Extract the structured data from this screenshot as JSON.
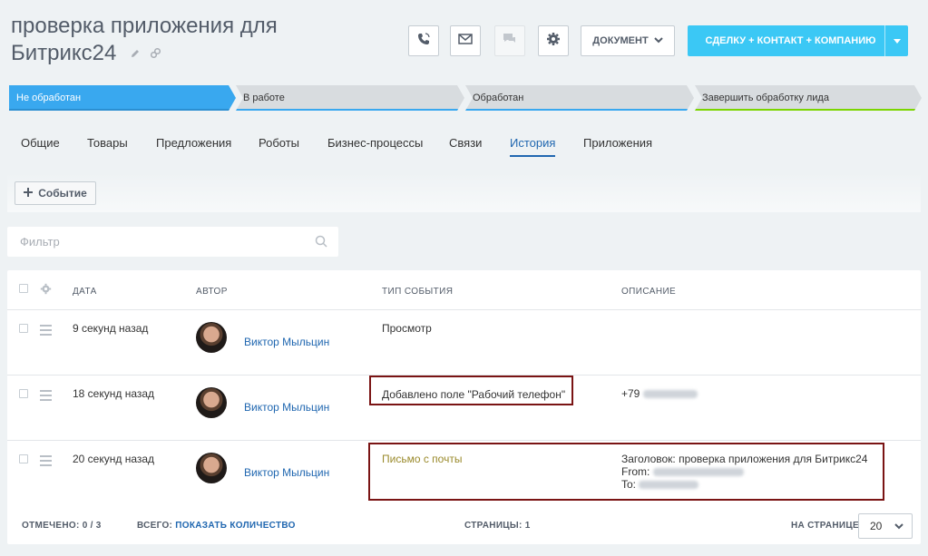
{
  "header": {
    "title_line1": "проверка приложения для",
    "title_line2": "Битрикс24",
    "document_button": "ДОКУМЕНТ",
    "main_button": "СДЕЛКУ + КОНТАКТ + КОМПАНИЮ"
  },
  "stages": [
    {
      "label": "Не обработан",
      "color": "#39a8ef"
    },
    {
      "label": "В работе",
      "color": "#39a8ef"
    },
    {
      "label": "Обработан",
      "color": "#39a8ef"
    },
    {
      "label": "Завершить обработку лида",
      "color": "#7bd500"
    }
  ],
  "tabs": [
    "Общие",
    "Товары",
    "Предложения",
    "Роботы",
    "Бизнес-процессы",
    "Связи",
    "История",
    "Приложения"
  ],
  "active_tab": "История",
  "toolbar": {
    "event_button": "Событие"
  },
  "filter": {
    "placeholder": "Фильтр"
  },
  "grid": {
    "columns": [
      "ДАТА",
      "АВТОР",
      "ТИП СОБЫТИЯ",
      "ОПИСАНИЕ"
    ],
    "rows": [
      {
        "date": "9 секунд назад",
        "author": "Виктор Мыльцин",
        "event_type": "Просмотр",
        "description": ""
      },
      {
        "date": "18 секунд назад",
        "author": "Виктор Мыльцин",
        "event_type": "Добавлено поле \"Рабочий телефон\"",
        "description": "+79"
      },
      {
        "date": "20 секунд назад",
        "author": "Виктор Мыльцин",
        "event_type": "Письмо с почты",
        "description": "Заголовок: проверка приложения для Битрикс24",
        "from_label": "From:",
        "to_label": "To:"
      }
    ]
  },
  "footer": {
    "selected_label": "ОТМЕЧЕНО: 0 / 3",
    "total_label": "ВСЕГО:",
    "total_link": "ПОКАЗАТЬ КОЛИЧЕСТВО",
    "pages_label": "СТРАНИЦЫ: 1",
    "per_page_label": "НА СТРАНИЦЕ:",
    "per_page_value": "20"
  },
  "colors": {
    "accent": "#3bc8f5",
    "link": "#2067b0",
    "email_event": "#9a8a2b",
    "highlight_box": "#7a1414"
  },
  "icons": [
    "phone-icon",
    "mail-icon",
    "chat-icon",
    "gear-icon",
    "pencil-icon",
    "link-icon",
    "plus-icon",
    "search-icon",
    "chevron-down-icon",
    "hamburger-icon"
  ]
}
